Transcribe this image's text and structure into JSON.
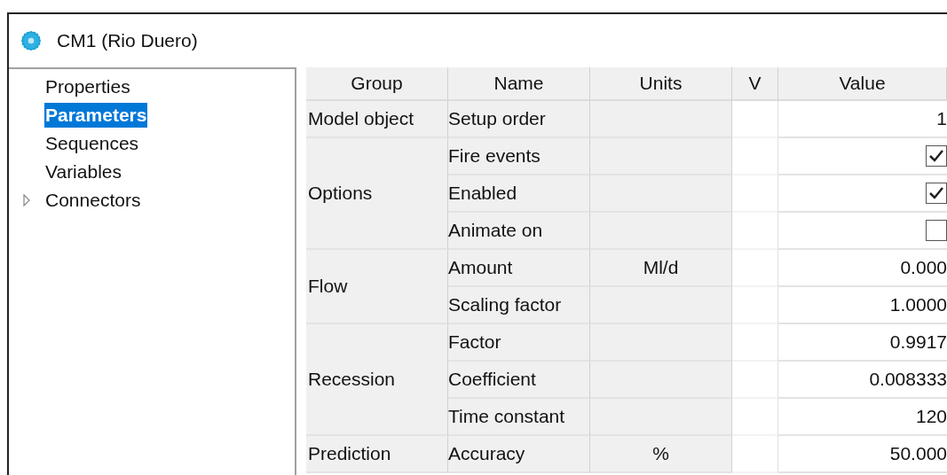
{
  "window": {
    "title": "CM1 (Rio Duero)"
  },
  "tree": {
    "items": [
      {
        "label": "Properties",
        "selected": false,
        "kind": "leaf"
      },
      {
        "label": "Parameters",
        "selected": true,
        "kind": "leaf"
      },
      {
        "label": "Sequences",
        "selected": false,
        "kind": "leaf"
      },
      {
        "label": "Variables",
        "selected": false,
        "kind": "leaf"
      },
      {
        "label": "Connectors",
        "selected": false,
        "kind": "branch",
        "expanded": false
      }
    ]
  },
  "table": {
    "columns": [
      "Group",
      "Name",
      "Units",
      "V",
      "Value"
    ],
    "groups": [
      {
        "label": "Model object",
        "rows": [
          {
            "name": "Setup order",
            "kind": "number",
            "value": "1"
          }
        ]
      },
      {
        "label": "Options",
        "rows": [
          {
            "name": "Fire events",
            "kind": "checkbox",
            "checked": true
          },
          {
            "name": "Enabled",
            "kind": "checkbox",
            "checked": true
          },
          {
            "name": "Animate on",
            "kind": "checkbox",
            "checked": false
          }
        ]
      },
      {
        "label": "Flow",
        "rows": [
          {
            "name": "Amount",
            "units": "Ml/d",
            "kind": "number",
            "value": "0.000"
          },
          {
            "name": "Scaling factor",
            "kind": "number",
            "value": "1.0000"
          }
        ]
      },
      {
        "label": "Recession",
        "rows": [
          {
            "name": "Factor",
            "kind": "number",
            "value": "0.9917"
          },
          {
            "name": "Coefficient",
            "kind": "number",
            "value": "0.008333"
          },
          {
            "name": "Time constant",
            "kind": "number",
            "value": "120"
          }
        ]
      },
      {
        "label": "Prediction",
        "rows": [
          {
            "name": "Accuracy",
            "units": "%",
            "kind": "number",
            "value": "50.000"
          }
        ]
      }
    ]
  }
}
